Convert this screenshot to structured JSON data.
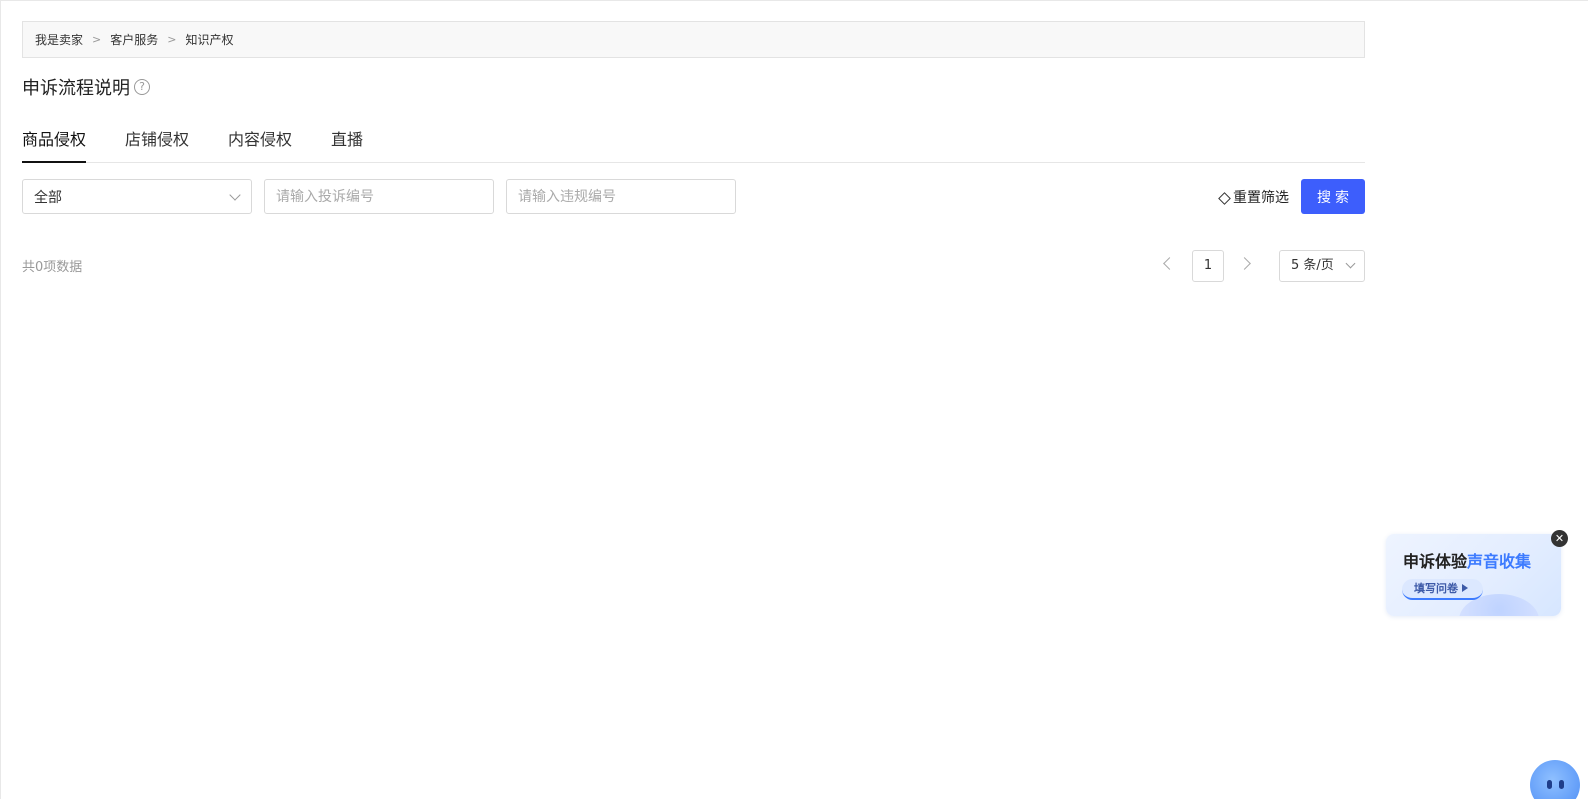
{
  "breadcrumb": [
    "我是卖家",
    "客户服务",
    "知识产权"
  ],
  "breadcrumb_separator": ">",
  "page_title": "申诉流程说明",
  "help_icon_glyph": "?",
  "tabs": [
    {
      "label": "商品侵权",
      "active": true
    },
    {
      "label": "店铺侵权",
      "active": false
    },
    {
      "label": "内容侵权",
      "active": false
    },
    {
      "label": "直播",
      "active": false
    }
  ],
  "filters": {
    "type_select_value": "全部",
    "complaint_no_placeholder": "请输入投诉编号",
    "violation_no_placeholder": "请输入违规编号",
    "reset_label": "重置筛选",
    "search_label": "搜索"
  },
  "result": {
    "total_text": "共0项数据"
  },
  "pagination": {
    "current_page": "1",
    "page_size_label": "5 条/页"
  },
  "survey_card": {
    "title_prefix": "申诉体验",
    "title_highlight": "声音收集",
    "button_label": "填写问卷",
    "close_glyph": "✕"
  },
  "colors": {
    "accent": "#3d5efc",
    "survey_highlight": "#3d7bff"
  }
}
